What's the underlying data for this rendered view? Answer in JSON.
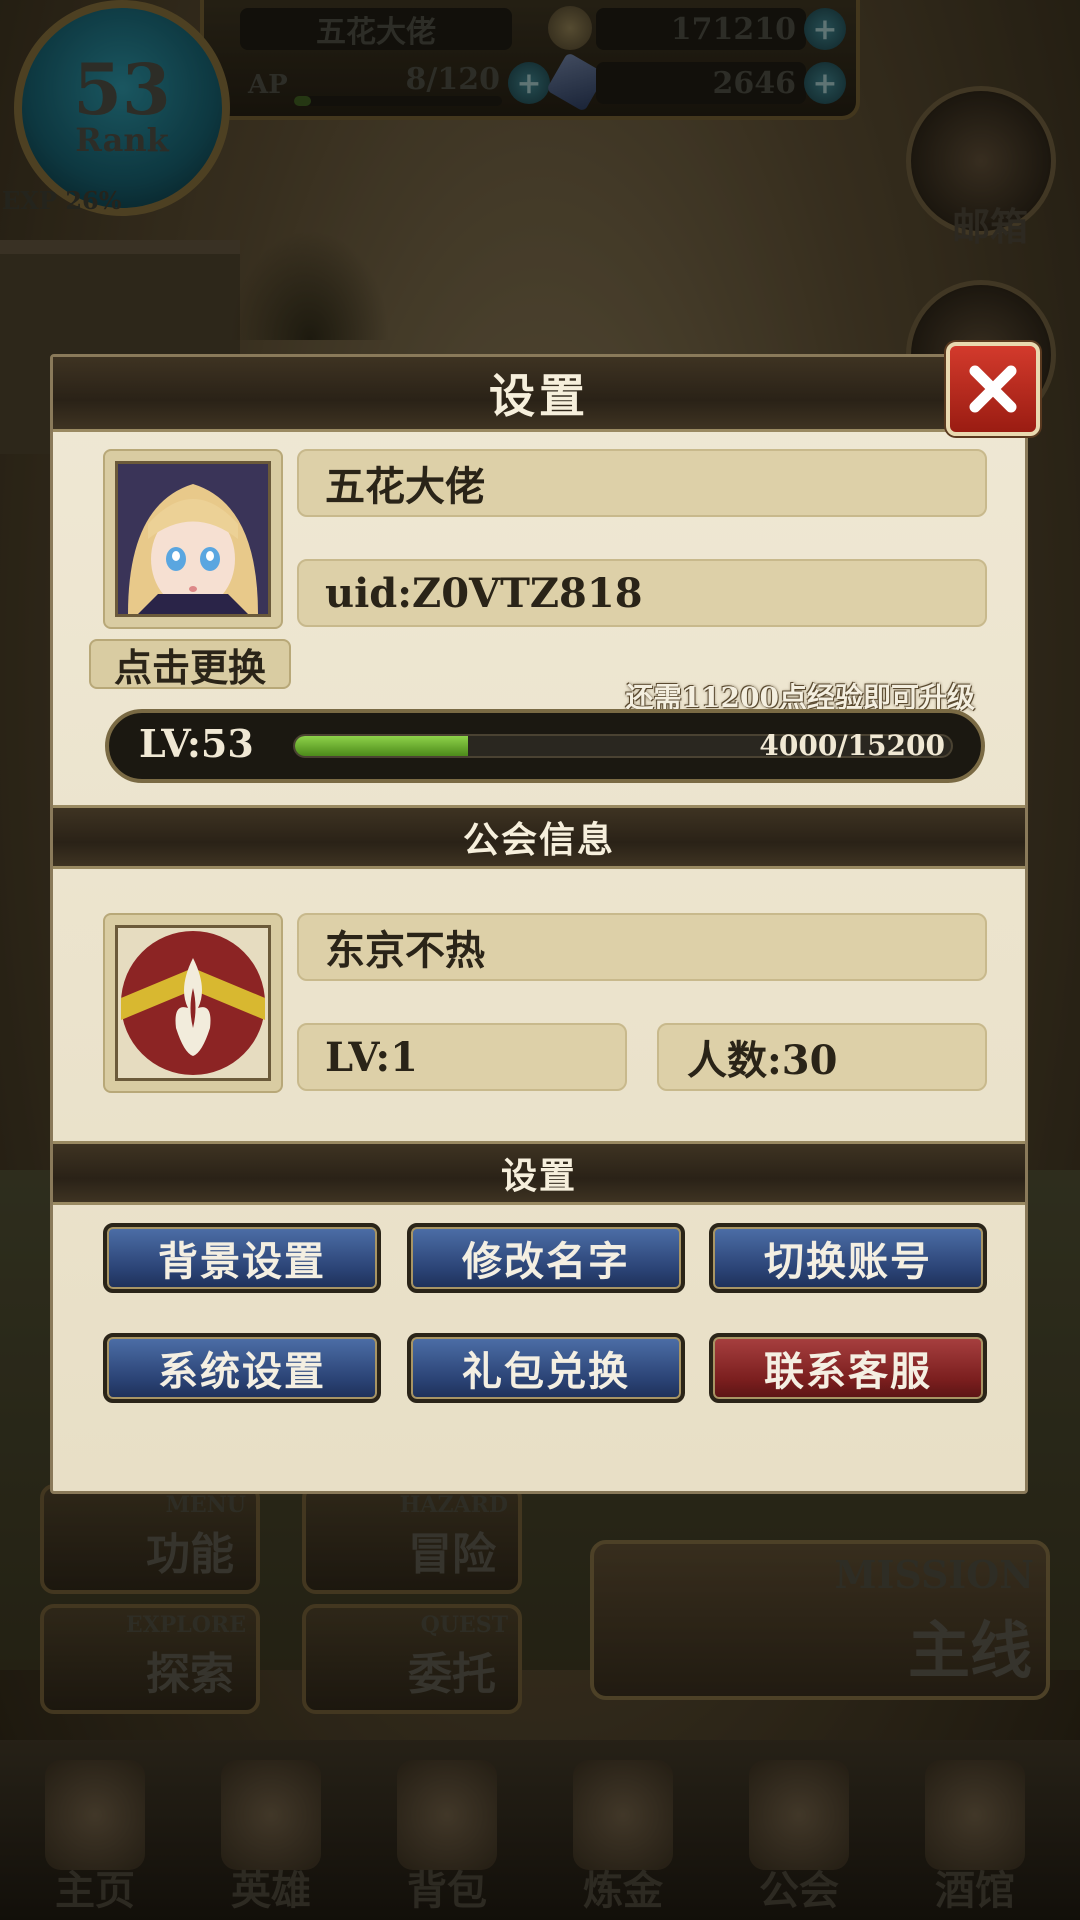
{
  "hud": {
    "player_name": "五花大佬",
    "rank_value": "53",
    "rank_label": "Rank",
    "exp_label": "EXP 26%",
    "ap_label": "AP",
    "ap_value": "8/120",
    "gold": "171210",
    "gems": "2646"
  },
  "side": {
    "mailbox_label": "邮箱"
  },
  "menu": {
    "function": {
      "en": "MENU",
      "zh": "功能"
    },
    "adventure": {
      "en": "HAZARD",
      "zh": "冒险"
    },
    "explore": {
      "en": "EXPLORE",
      "zh": "探索"
    },
    "quest": {
      "en": "QUEST",
      "zh": "委托"
    },
    "mission": {
      "en": "MISSION",
      "zh": "主线"
    }
  },
  "nav": [
    "主页",
    "英雄",
    "背包",
    "炼金",
    "公会",
    "酒馆"
  ],
  "dialog": {
    "title": "设置",
    "player": {
      "name": "五花大佬",
      "uid": "uid:Z0VTZ818",
      "change_avatar": "点击更换",
      "exp_hint": "还需11200点经验即可升级",
      "level": "LV:53",
      "exp_text": "4000/15200",
      "exp_current": 4000,
      "exp_max": 15200
    },
    "guild_section": "公会信息",
    "guild": {
      "name": "东京不热",
      "level": "LV:1",
      "members": "人数:30"
    },
    "settings_section": "设置",
    "buttons": {
      "background": "背景设置",
      "rename": "修改名字",
      "switch_account": "切换账号",
      "system": "系统设置",
      "gift_code": "礼包兑换",
      "support": "联系客服"
    }
  },
  "colors": {
    "accent_blue": "#2a4274",
    "accent_red": "#7a1e1e",
    "exp_green": "#6fb533",
    "close_red": "#c0302a"
  }
}
